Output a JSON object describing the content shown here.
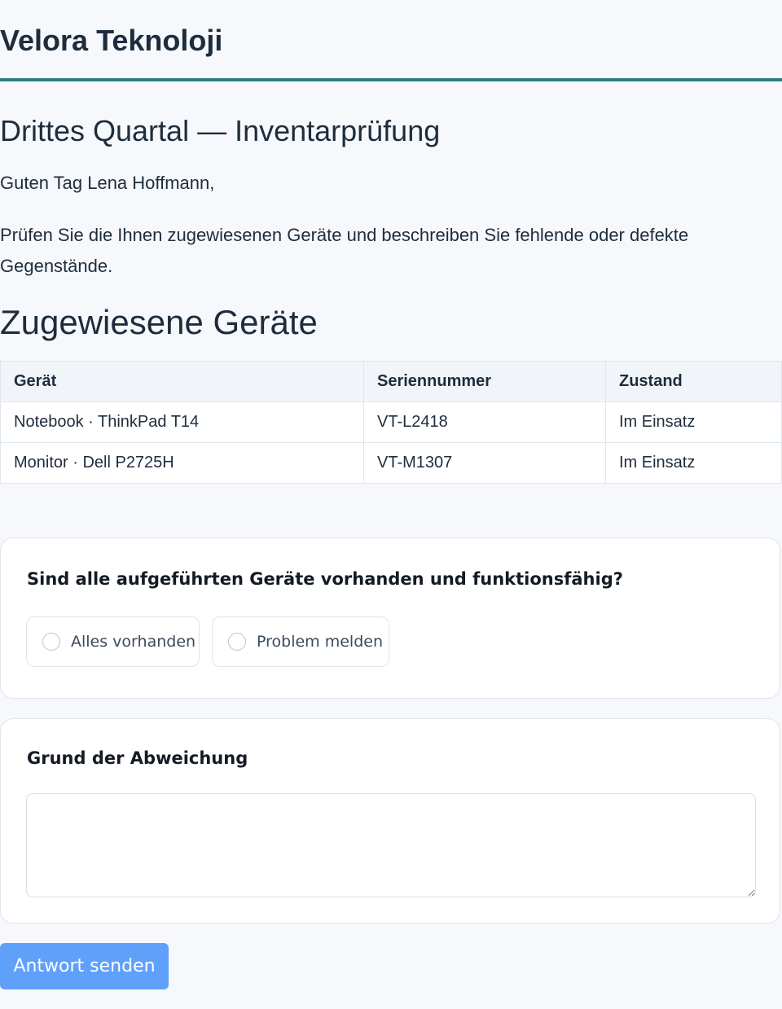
{
  "brand": {
    "name": "Velora Teknoloji"
  },
  "survey": {
    "title": "Drittes Quartal — Inventarprüfung",
    "greeting": "Guten Tag Lena Hoffmann,",
    "instructions": "Prüfen Sie die Ihnen zugewiesenen Geräte und beschreiben Sie fehlende oder defekte Gegenstände."
  },
  "devices": {
    "heading": "Zugewiesene Geräte",
    "columns": [
      "Gerät",
      "Seriennummer",
      "Zustand"
    ],
    "rows": [
      [
        "Notebook · ThinkPad T14",
        "VT-L2418",
        "Im Einsatz"
      ],
      [
        "Monitor · Dell P2725H",
        "VT-M1307",
        "Im Einsatz"
      ]
    ]
  },
  "question": {
    "label": "Sind alle aufgeführten Geräte vorhanden und funktionsfähig?",
    "options": [
      "Alles vorhanden",
      "Problem melden"
    ]
  },
  "reason": {
    "label": "Grund der Abweichung",
    "value": ""
  },
  "submit": {
    "label": "Antwort senden"
  },
  "colors": {
    "accent": "#2a7f86",
    "button": "#5fa0fb",
    "background": "#f6f8fb"
  }
}
